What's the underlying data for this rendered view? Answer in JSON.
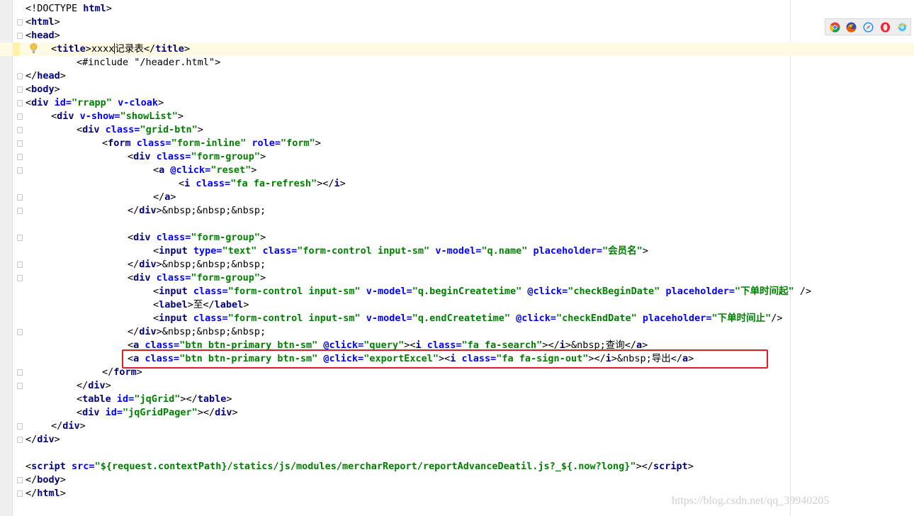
{
  "editor": {
    "lines": [
      {
        "fold": false,
        "tokens": [
          {
            "t": "<!DOCTYPE ",
            "c": "txt"
          },
          {
            "t": "html",
            "c": "tag"
          },
          {
            "t": ">",
            "c": "txt"
          }
        ]
      },
      {
        "fold": true,
        "tokens": [
          {
            "t": "<",
            "c": "txt"
          },
          {
            "t": "html",
            "c": "tag"
          },
          {
            "t": ">",
            "c": "txt"
          }
        ]
      },
      {
        "fold": true,
        "tokens": [
          {
            "t": "<",
            "c": "txt"
          },
          {
            "t": "head",
            "c": "tag"
          },
          {
            "t": ">",
            "c": "txt"
          }
        ]
      },
      {
        "fold": false,
        "indent": 1,
        "tokens": [
          {
            "t": "<",
            "c": "txt"
          },
          {
            "t": "title",
            "c": "tag"
          },
          {
            "t": ">xxxx",
            "c": "txt"
          },
          {
            "t": "记录表",
            "c": "txt"
          },
          {
            "t": "</",
            "c": "txt"
          },
          {
            "t": "title",
            "c": "tag"
          },
          {
            "t": ">",
            "c": "txt"
          }
        ]
      },
      {
        "fold": false,
        "indent": 2,
        "tokens": [
          {
            "t": "<#include \"/header.html\">",
            "c": "txt"
          }
        ]
      },
      {
        "fold": true,
        "tokens": [
          {
            "t": "</",
            "c": "txt"
          },
          {
            "t": "head",
            "c": "tag"
          },
          {
            "t": ">",
            "c": "txt"
          }
        ]
      },
      {
        "fold": true,
        "tokens": [
          {
            "t": "<",
            "c": "txt"
          },
          {
            "t": "body",
            "c": "tag"
          },
          {
            "t": ">",
            "c": "txt"
          }
        ]
      },
      {
        "fold": true,
        "tokens": [
          {
            "t": "<",
            "c": "txt"
          },
          {
            "t": "div ",
            "c": "tag"
          },
          {
            "t": "id=",
            "c": "attr"
          },
          {
            "t": "\"rrapp\"",
            "c": "str"
          },
          {
            "t": " v-cloak",
            "c": "attr"
          },
          {
            "t": ">",
            "c": "txt"
          }
        ]
      },
      {
        "fold": true,
        "indent": 1,
        "tokens": [
          {
            "t": "<",
            "c": "txt"
          },
          {
            "t": "div ",
            "c": "tag"
          },
          {
            "t": "v-show=",
            "c": "attr"
          },
          {
            "t": "\"showList\"",
            "c": "str"
          },
          {
            "t": ">",
            "c": "txt"
          }
        ]
      },
      {
        "fold": true,
        "indent": 2,
        "tokens": [
          {
            "t": "<",
            "c": "txt"
          },
          {
            "t": "div ",
            "c": "tag"
          },
          {
            "t": "class=",
            "c": "attr"
          },
          {
            "t": "\"grid-btn\"",
            "c": "str"
          },
          {
            "t": ">",
            "c": "txt"
          }
        ]
      },
      {
        "fold": true,
        "indent": 3,
        "tokens": [
          {
            "t": "<",
            "c": "txt"
          },
          {
            "t": "form ",
            "c": "tag"
          },
          {
            "t": "class=",
            "c": "attr"
          },
          {
            "t": "\"form-inline\"",
            "c": "str"
          },
          {
            "t": " role=",
            "c": "attr"
          },
          {
            "t": "\"form\"",
            "c": "str"
          },
          {
            "t": ">",
            "c": "txt"
          }
        ]
      },
      {
        "fold": true,
        "indent": 4,
        "tokens": [
          {
            "t": "<",
            "c": "txt"
          },
          {
            "t": "div ",
            "c": "tag"
          },
          {
            "t": "class=",
            "c": "attr"
          },
          {
            "t": "\"form-group\"",
            "c": "str"
          },
          {
            "t": ">",
            "c": "txt"
          }
        ]
      },
      {
        "fold": true,
        "indent": 5,
        "tokens": [
          {
            "t": "<",
            "c": "txt"
          },
          {
            "t": "a ",
            "c": "tag"
          },
          {
            "t": "@click=",
            "c": "attr"
          },
          {
            "t": "\"reset\"",
            "c": "str"
          },
          {
            "t": ">",
            "c": "txt"
          }
        ]
      },
      {
        "fold": false,
        "indent": 6,
        "tokens": [
          {
            "t": "<",
            "c": "txt"
          },
          {
            "t": "i ",
            "c": "tag"
          },
          {
            "t": "class=",
            "c": "attr"
          },
          {
            "t": "\"fa fa-refresh\"",
            "c": "str"
          },
          {
            "t": "></",
            "c": "txt"
          },
          {
            "t": "i",
            "c": "tag"
          },
          {
            "t": ">",
            "c": "txt"
          }
        ]
      },
      {
        "fold": true,
        "indent": 5,
        "tokens": [
          {
            "t": "</",
            "c": "txt"
          },
          {
            "t": "a",
            "c": "tag"
          },
          {
            "t": ">",
            "c": "txt"
          }
        ]
      },
      {
        "fold": true,
        "indent": 4,
        "tokens": [
          {
            "t": "</",
            "c": "txt"
          },
          {
            "t": "div",
            "c": "tag"
          },
          {
            "t": ">&nbsp;&nbsp;&nbsp;",
            "c": "txt"
          }
        ]
      },
      {
        "fold": false,
        "tokens": []
      },
      {
        "fold": true,
        "indent": 4,
        "tokens": [
          {
            "t": "<",
            "c": "txt"
          },
          {
            "t": "div ",
            "c": "tag"
          },
          {
            "t": "class=",
            "c": "attr"
          },
          {
            "t": "\"form-group\"",
            "c": "str"
          },
          {
            "t": ">",
            "c": "txt"
          }
        ]
      },
      {
        "fold": false,
        "indent": 5,
        "tokens": [
          {
            "t": "<",
            "c": "txt"
          },
          {
            "t": "input ",
            "c": "tag"
          },
          {
            "t": "type=",
            "c": "attr"
          },
          {
            "t": "\"text\"",
            "c": "str"
          },
          {
            "t": " class=",
            "c": "attr"
          },
          {
            "t": "\"form-control input-sm\"",
            "c": "str"
          },
          {
            "t": " v-model=",
            "c": "attr"
          },
          {
            "t": "\"q.name\"",
            "c": "str"
          },
          {
            "t": " placeholder=",
            "c": "attr"
          },
          {
            "t": "\"会员名\"",
            "c": "str"
          },
          {
            "t": ">",
            "c": "txt"
          }
        ]
      },
      {
        "fold": true,
        "indent": 4,
        "tokens": [
          {
            "t": "</",
            "c": "txt"
          },
          {
            "t": "div",
            "c": "tag"
          },
          {
            "t": ">&nbsp;&nbsp;&nbsp;",
            "c": "txt"
          }
        ]
      },
      {
        "fold": true,
        "indent": 4,
        "tokens": [
          {
            "t": "<",
            "c": "txt"
          },
          {
            "t": "div ",
            "c": "tag"
          },
          {
            "t": "class=",
            "c": "attr"
          },
          {
            "t": "\"form-group\"",
            "c": "str"
          },
          {
            "t": ">",
            "c": "txt"
          }
        ]
      },
      {
        "fold": false,
        "indent": 5,
        "tokens": [
          {
            "t": "<",
            "c": "txt"
          },
          {
            "t": "input ",
            "c": "tag"
          },
          {
            "t": "class=",
            "c": "attr"
          },
          {
            "t": "\"form-control input-sm\"",
            "c": "str"
          },
          {
            "t": " v-model=",
            "c": "attr"
          },
          {
            "t": "\"q.beginCreatetime\"",
            "c": "str"
          },
          {
            "t": " @click=",
            "c": "attr"
          },
          {
            "t": "\"checkBeginDate\"",
            "c": "str"
          },
          {
            "t": " placeholder=",
            "c": "attr"
          },
          {
            "t": "\"下单时间起\"",
            "c": "str"
          },
          {
            "t": " />",
            "c": "txt"
          }
        ]
      },
      {
        "fold": false,
        "indent": 5,
        "tokens": [
          {
            "t": "<",
            "c": "txt"
          },
          {
            "t": "label",
            "c": "tag"
          },
          {
            "t": ">至</",
            "c": "txt"
          },
          {
            "t": "label",
            "c": "tag"
          },
          {
            "t": ">",
            "c": "txt"
          }
        ]
      },
      {
        "fold": false,
        "indent": 5,
        "tokens": [
          {
            "t": "<",
            "c": "txt"
          },
          {
            "t": "input ",
            "c": "tag"
          },
          {
            "t": "class=",
            "c": "attr"
          },
          {
            "t": "\"form-control input-sm\"",
            "c": "str"
          },
          {
            "t": " v-model=",
            "c": "attr"
          },
          {
            "t": "\"q.endCreatetime\"",
            "c": "str"
          },
          {
            "t": " @click=",
            "c": "attr"
          },
          {
            "t": "\"checkEndDate\"",
            "c": "str"
          },
          {
            "t": " placeholder=",
            "c": "attr"
          },
          {
            "t": "\"下单时间止\"",
            "c": "str"
          },
          {
            "t": "/>",
            "c": "txt"
          }
        ]
      },
      {
        "fold": true,
        "indent": 4,
        "tokens": [
          {
            "t": "</",
            "c": "txt"
          },
          {
            "t": "div",
            "c": "tag"
          },
          {
            "t": ">&nbsp;&nbsp;&nbsp;",
            "c": "txt"
          }
        ]
      },
      {
        "fold": false,
        "indent": 4,
        "tokens": [
          {
            "t": "<",
            "c": "txt"
          },
          {
            "t": "a ",
            "c": "tag"
          },
          {
            "t": "class=",
            "c": "attr"
          },
          {
            "t": "\"btn btn-primary btn-sm\"",
            "c": "str"
          },
          {
            "t": " @click=",
            "c": "attr"
          },
          {
            "t": "\"query\"",
            "c": "str"
          },
          {
            "t": "><",
            "c": "txt"
          },
          {
            "t": "i ",
            "c": "tag"
          },
          {
            "t": "class=",
            "c": "attr"
          },
          {
            "t": "\"fa fa-search\"",
            "c": "str"
          },
          {
            "t": "></",
            "c": "txt"
          },
          {
            "t": "i",
            "c": "tag"
          },
          {
            "t": ">&nbsp;查询</",
            "c": "txt"
          },
          {
            "t": "a",
            "c": "tag"
          },
          {
            "t": ">",
            "c": "txt"
          }
        ]
      },
      {
        "fold": false,
        "indent": 4,
        "tokens": [
          {
            "t": "<",
            "c": "txt"
          },
          {
            "t": "a ",
            "c": "tag"
          },
          {
            "t": "class=",
            "c": "attr"
          },
          {
            "t": "\"btn btn-primary btn-sm\"",
            "c": "str"
          },
          {
            "t": " @click=",
            "c": "attr"
          },
          {
            "t": "\"exportExcel\"",
            "c": "str"
          },
          {
            "t": "><",
            "c": "txt"
          },
          {
            "t": "i ",
            "c": "tag"
          },
          {
            "t": "class=",
            "c": "attr"
          },
          {
            "t": "\"fa fa-sign-out\"",
            "c": "str"
          },
          {
            "t": "></",
            "c": "txt"
          },
          {
            "t": "i",
            "c": "tag"
          },
          {
            "t": ">&nbsp;导出</",
            "c": "txt"
          },
          {
            "t": "a",
            "c": "tag"
          },
          {
            "t": ">",
            "c": "txt"
          }
        ]
      },
      {
        "fold": true,
        "indent": 3,
        "tokens": [
          {
            "t": "</",
            "c": "txt"
          },
          {
            "t": "form",
            "c": "tag"
          },
          {
            "t": ">",
            "c": "txt"
          }
        ]
      },
      {
        "fold": true,
        "indent": 2,
        "tokens": [
          {
            "t": "</",
            "c": "txt"
          },
          {
            "t": "div",
            "c": "tag"
          },
          {
            "t": ">",
            "c": "txt"
          }
        ]
      },
      {
        "fold": false,
        "indent": 2,
        "tokens": [
          {
            "t": "<",
            "c": "txt"
          },
          {
            "t": "table ",
            "c": "tag"
          },
          {
            "t": "id=",
            "c": "attr"
          },
          {
            "t": "\"jqGrid\"",
            "c": "str"
          },
          {
            "t": "></",
            "c": "txt"
          },
          {
            "t": "table",
            "c": "tag"
          },
          {
            "t": ">",
            "c": "txt"
          }
        ]
      },
      {
        "fold": false,
        "indent": 2,
        "tokens": [
          {
            "t": "<",
            "c": "txt"
          },
          {
            "t": "div ",
            "c": "tag"
          },
          {
            "t": "id=",
            "c": "attr"
          },
          {
            "t": "\"jqGridPager\"",
            "c": "str"
          },
          {
            "t": "></",
            "c": "txt"
          },
          {
            "t": "div",
            "c": "tag"
          },
          {
            "t": ">",
            "c": "txt"
          }
        ]
      },
      {
        "fold": true,
        "indent": 1,
        "tokens": [
          {
            "t": "</",
            "c": "txt"
          },
          {
            "t": "div",
            "c": "tag"
          },
          {
            "t": ">",
            "c": "txt"
          }
        ]
      },
      {
        "fold": true,
        "tokens": [
          {
            "t": "</",
            "c": "txt"
          },
          {
            "t": "div",
            "c": "tag"
          },
          {
            "t": ">",
            "c": "txt"
          }
        ]
      },
      {
        "fold": false,
        "tokens": []
      },
      {
        "fold": false,
        "tokens": [
          {
            "t": "<",
            "c": "txt"
          },
          {
            "t": "script ",
            "c": "tag"
          },
          {
            "t": "src=",
            "c": "attr"
          },
          {
            "t": "\"${request.contextPath}/statics/js/modules/mercharReport/reportAdvanceDeatil.js?_${.now?long}\"",
            "c": "str"
          },
          {
            "t": "></",
            "c": "txt"
          },
          {
            "t": "script",
            "c": "tag"
          },
          {
            "t": ">",
            "c": "txt"
          }
        ]
      },
      {
        "fold": true,
        "tokens": [
          {
            "t": "</",
            "c": "txt"
          },
          {
            "t": "body",
            "c": "tag"
          },
          {
            "t": ">",
            "c": "txt"
          }
        ]
      },
      {
        "fold": true,
        "tokens": [
          {
            "t": "</",
            "c": "txt"
          },
          {
            "t": "html",
            "c": "tag"
          },
          {
            "t": ">",
            "c": "txt"
          }
        ]
      }
    ],
    "highlighted_line_index": 3,
    "boxed_line_index": 26
  },
  "browser_icons": [
    {
      "name": "chrome-icon",
      "color": "#db4437"
    },
    {
      "name": "firefox-icon",
      "color": "#e66000"
    },
    {
      "name": "safari-icon",
      "color": "#1e88e5"
    },
    {
      "name": "opera-icon",
      "color": "#ff1b2d"
    },
    {
      "name": "ie-icon",
      "color": "#4fc3f7"
    }
  ],
  "watermark": "https://blog.csdn.net/qq_39940205",
  "colors": {
    "tag": "#000080",
    "attr": "#0000ff",
    "string": "#008000",
    "highlight_box": "#e02020"
  }
}
